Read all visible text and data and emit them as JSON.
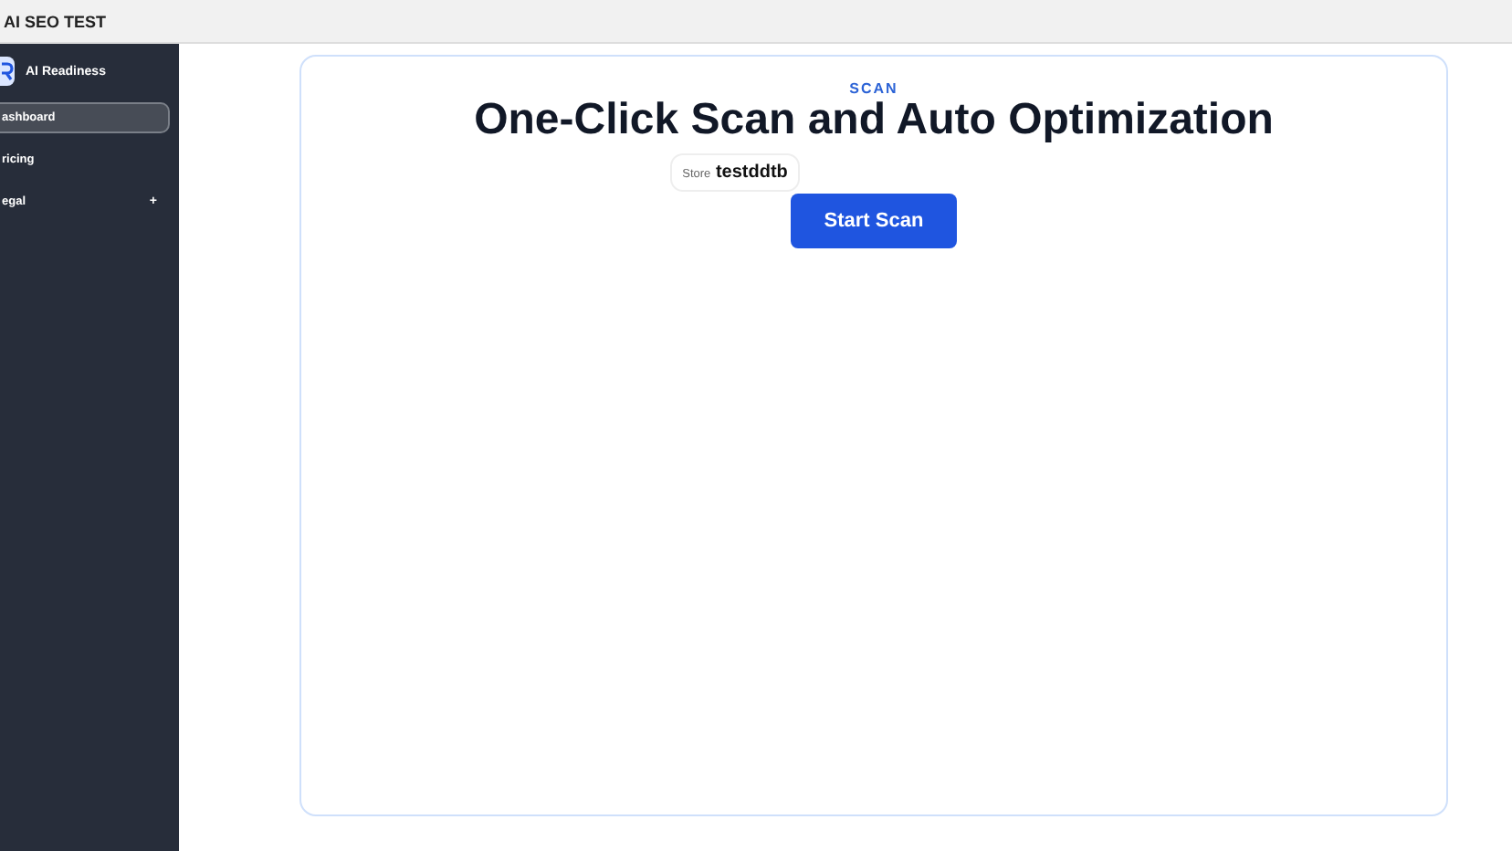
{
  "window": {
    "title": "AI SEO TEST"
  },
  "sidebar": {
    "brand": "AI Readiness",
    "items": [
      {
        "label": "ashboard",
        "selected": true
      },
      {
        "label": "ricing",
        "selected": false
      },
      {
        "label": "egal",
        "selected": false,
        "expand_icon": "+"
      }
    ]
  },
  "main": {
    "eyebrow": "SCAN",
    "heading": "One-Click Scan and Auto Optimization",
    "store_label": "Store",
    "store_name": "testddtb",
    "button": "Start Scan"
  }
}
